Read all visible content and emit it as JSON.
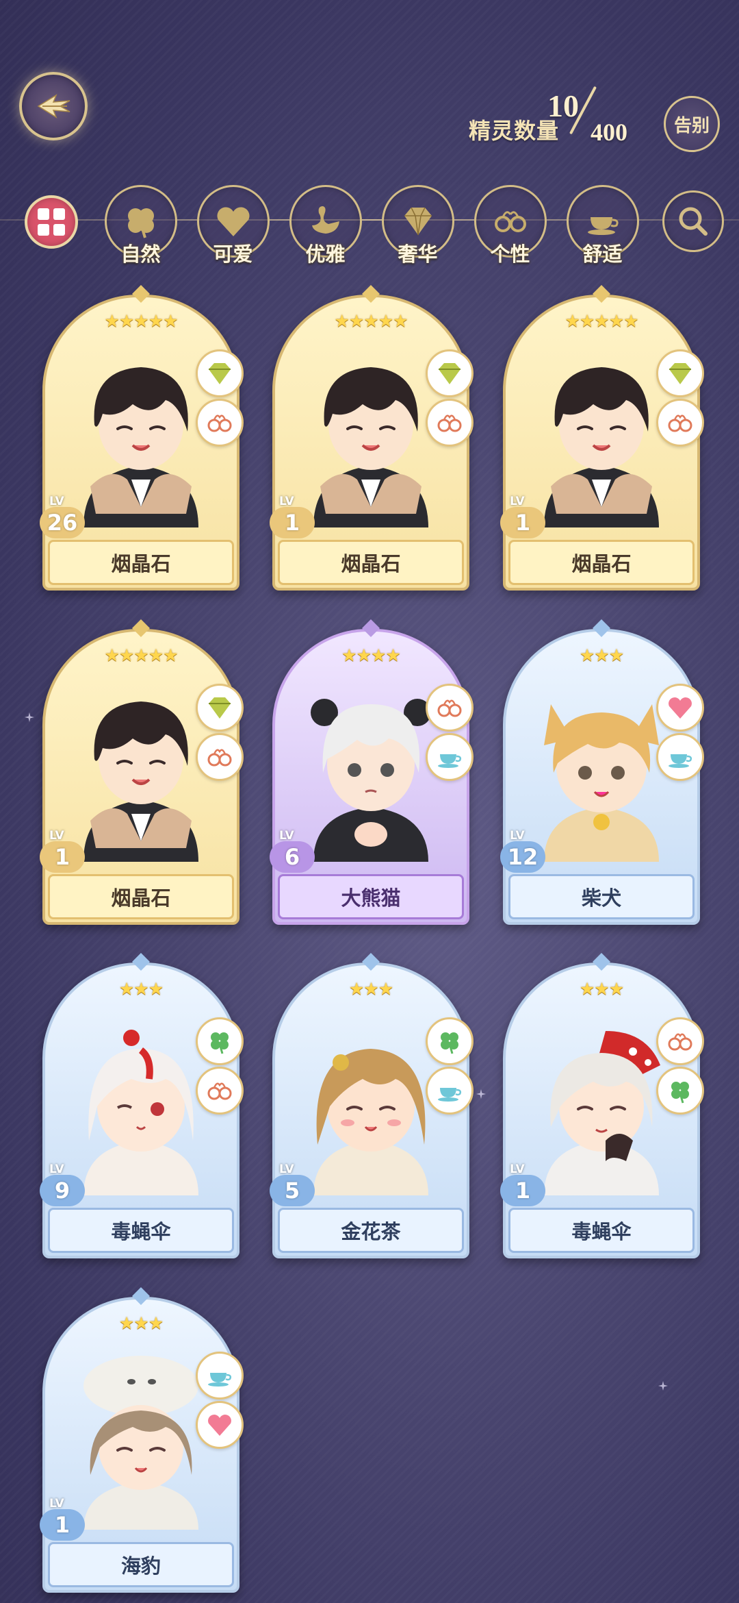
{
  "header": {
    "count_label": "精灵数量",
    "count_current": "10",
    "count_max": "400",
    "farewell_label": "告别"
  },
  "filters": [
    {
      "label": "",
      "icon": "grid-icon"
    },
    {
      "label": "自然",
      "icon": "clover-icon"
    },
    {
      "label": "可爱",
      "icon": "heart-icon"
    },
    {
      "label": "优雅",
      "icon": "swan-icon"
    },
    {
      "label": "奢华",
      "icon": "diamond-icon"
    },
    {
      "label": "个性",
      "icon": "glasses-icon"
    },
    {
      "label": "舒适",
      "icon": "teacup-icon"
    },
    {
      "label": "",
      "icon": "search-icon"
    }
  ],
  "cards": [
    {
      "name": "烟晶石",
      "level": "26",
      "lv_tag": "LV",
      "stars": "★★★★★",
      "rarity": "gold",
      "attrs": [
        "diamond-icon",
        "glasses-icon"
      ]
    },
    {
      "name": "烟晶石",
      "level": "1",
      "lv_tag": "LV",
      "stars": "★★★★★",
      "rarity": "gold",
      "attrs": [
        "diamond-icon",
        "glasses-icon"
      ]
    },
    {
      "name": "烟晶石",
      "level": "1",
      "lv_tag": "LV",
      "stars": "★★★★★",
      "rarity": "gold",
      "attrs": [
        "diamond-icon",
        "glasses-icon"
      ]
    },
    {
      "name": "烟晶石",
      "level": "1",
      "lv_tag": "LV",
      "stars": "★★★★★",
      "rarity": "gold",
      "attrs": [
        "diamond-icon",
        "glasses-icon"
      ]
    },
    {
      "name": "大熊猫",
      "level": "6",
      "lv_tag": "LV",
      "stars": "★★★★",
      "rarity": "purple",
      "attrs": [
        "glasses-icon",
        "teacup-icon"
      ]
    },
    {
      "name": "柴犬",
      "level": "12",
      "lv_tag": "LV",
      "stars": "★★★",
      "rarity": "blue",
      "attrs": [
        "heart-icon",
        "teacup-icon"
      ]
    },
    {
      "name": "毒蝇伞",
      "level": "9",
      "lv_tag": "LV",
      "stars": "★★★",
      "rarity": "blue",
      "attrs": [
        "clover-icon",
        "glasses-icon"
      ]
    },
    {
      "name": "金花茶",
      "level": "5",
      "lv_tag": "LV",
      "stars": "★★★",
      "rarity": "blue",
      "attrs": [
        "clover-icon",
        "teacup-icon"
      ]
    },
    {
      "name": "毒蝇伞",
      "level": "1",
      "lv_tag": "LV",
      "stars": "★★★",
      "rarity": "blue",
      "attrs": [
        "glasses-icon",
        "clover-icon"
      ]
    },
    {
      "name": "海豹",
      "level": "1",
      "lv_tag": "LV",
      "stars": "★★★",
      "rarity": "blue",
      "attrs": [
        "teacup-icon",
        "heart-icon"
      ]
    }
  ]
}
